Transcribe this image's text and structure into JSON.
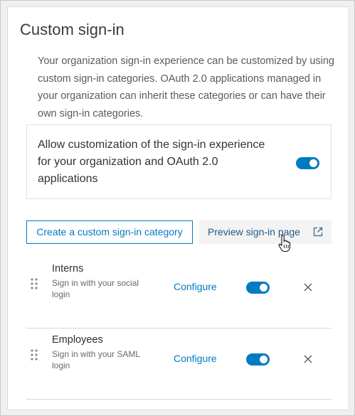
{
  "panel": {
    "title": "Custom sign-in",
    "description": "Your organization sign-in experience can be customized by using custom sign-in categories. OAuth 2.0 applications managed in your organization can inherit these categories or can have their own sign-in categories."
  },
  "allow": {
    "text": "Allow customization of the sign-in experience for your organization and OAuth 2.0 applications",
    "enabled": true
  },
  "actions": {
    "create_label": "Create a custom sign-in category",
    "preview_label": "Preview sign-in page"
  },
  "categories": [
    {
      "name": "Interns",
      "subtitle": "Sign in with your social login",
      "configure_label": "Configure",
      "enabled": true
    },
    {
      "name": "Employees",
      "subtitle": "Sign in with your SAML login",
      "configure_label": "Configure",
      "enabled": true
    }
  ],
  "colors": {
    "accent": "#007ac2"
  }
}
